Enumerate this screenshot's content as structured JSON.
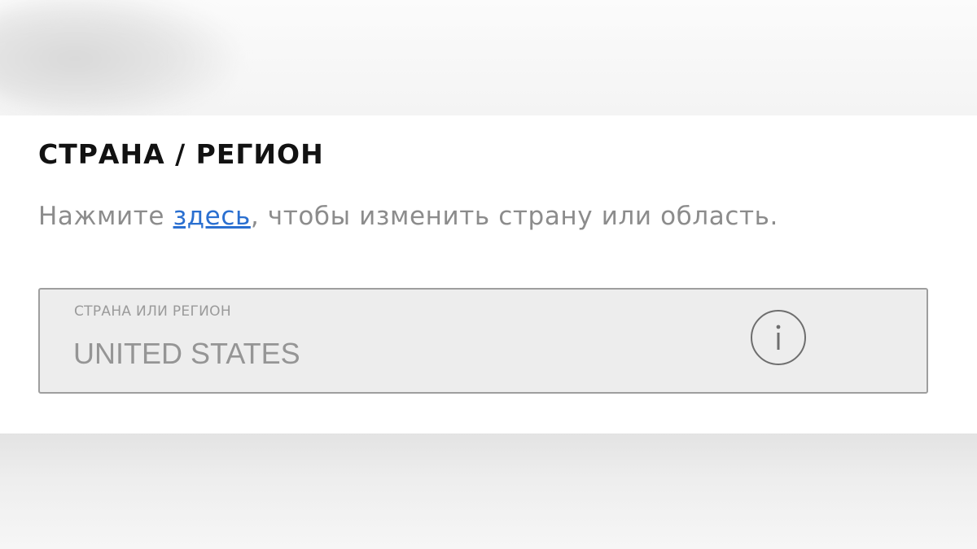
{
  "section": {
    "title": "СТРАНА / РЕГИОН",
    "description_before": "Нажмите ",
    "description_link": "здесь",
    "description_after": ", чтобы изменить страну или область."
  },
  "country_field": {
    "label": "СТРАНА ИЛИ РЕГИОН",
    "value": "UNITED STATES",
    "icon": "info-icon"
  },
  "colors": {
    "link": "#2a6fd0",
    "title": "#121212",
    "field_background": "#ededed",
    "field_border": "#9e9e9e"
  }
}
